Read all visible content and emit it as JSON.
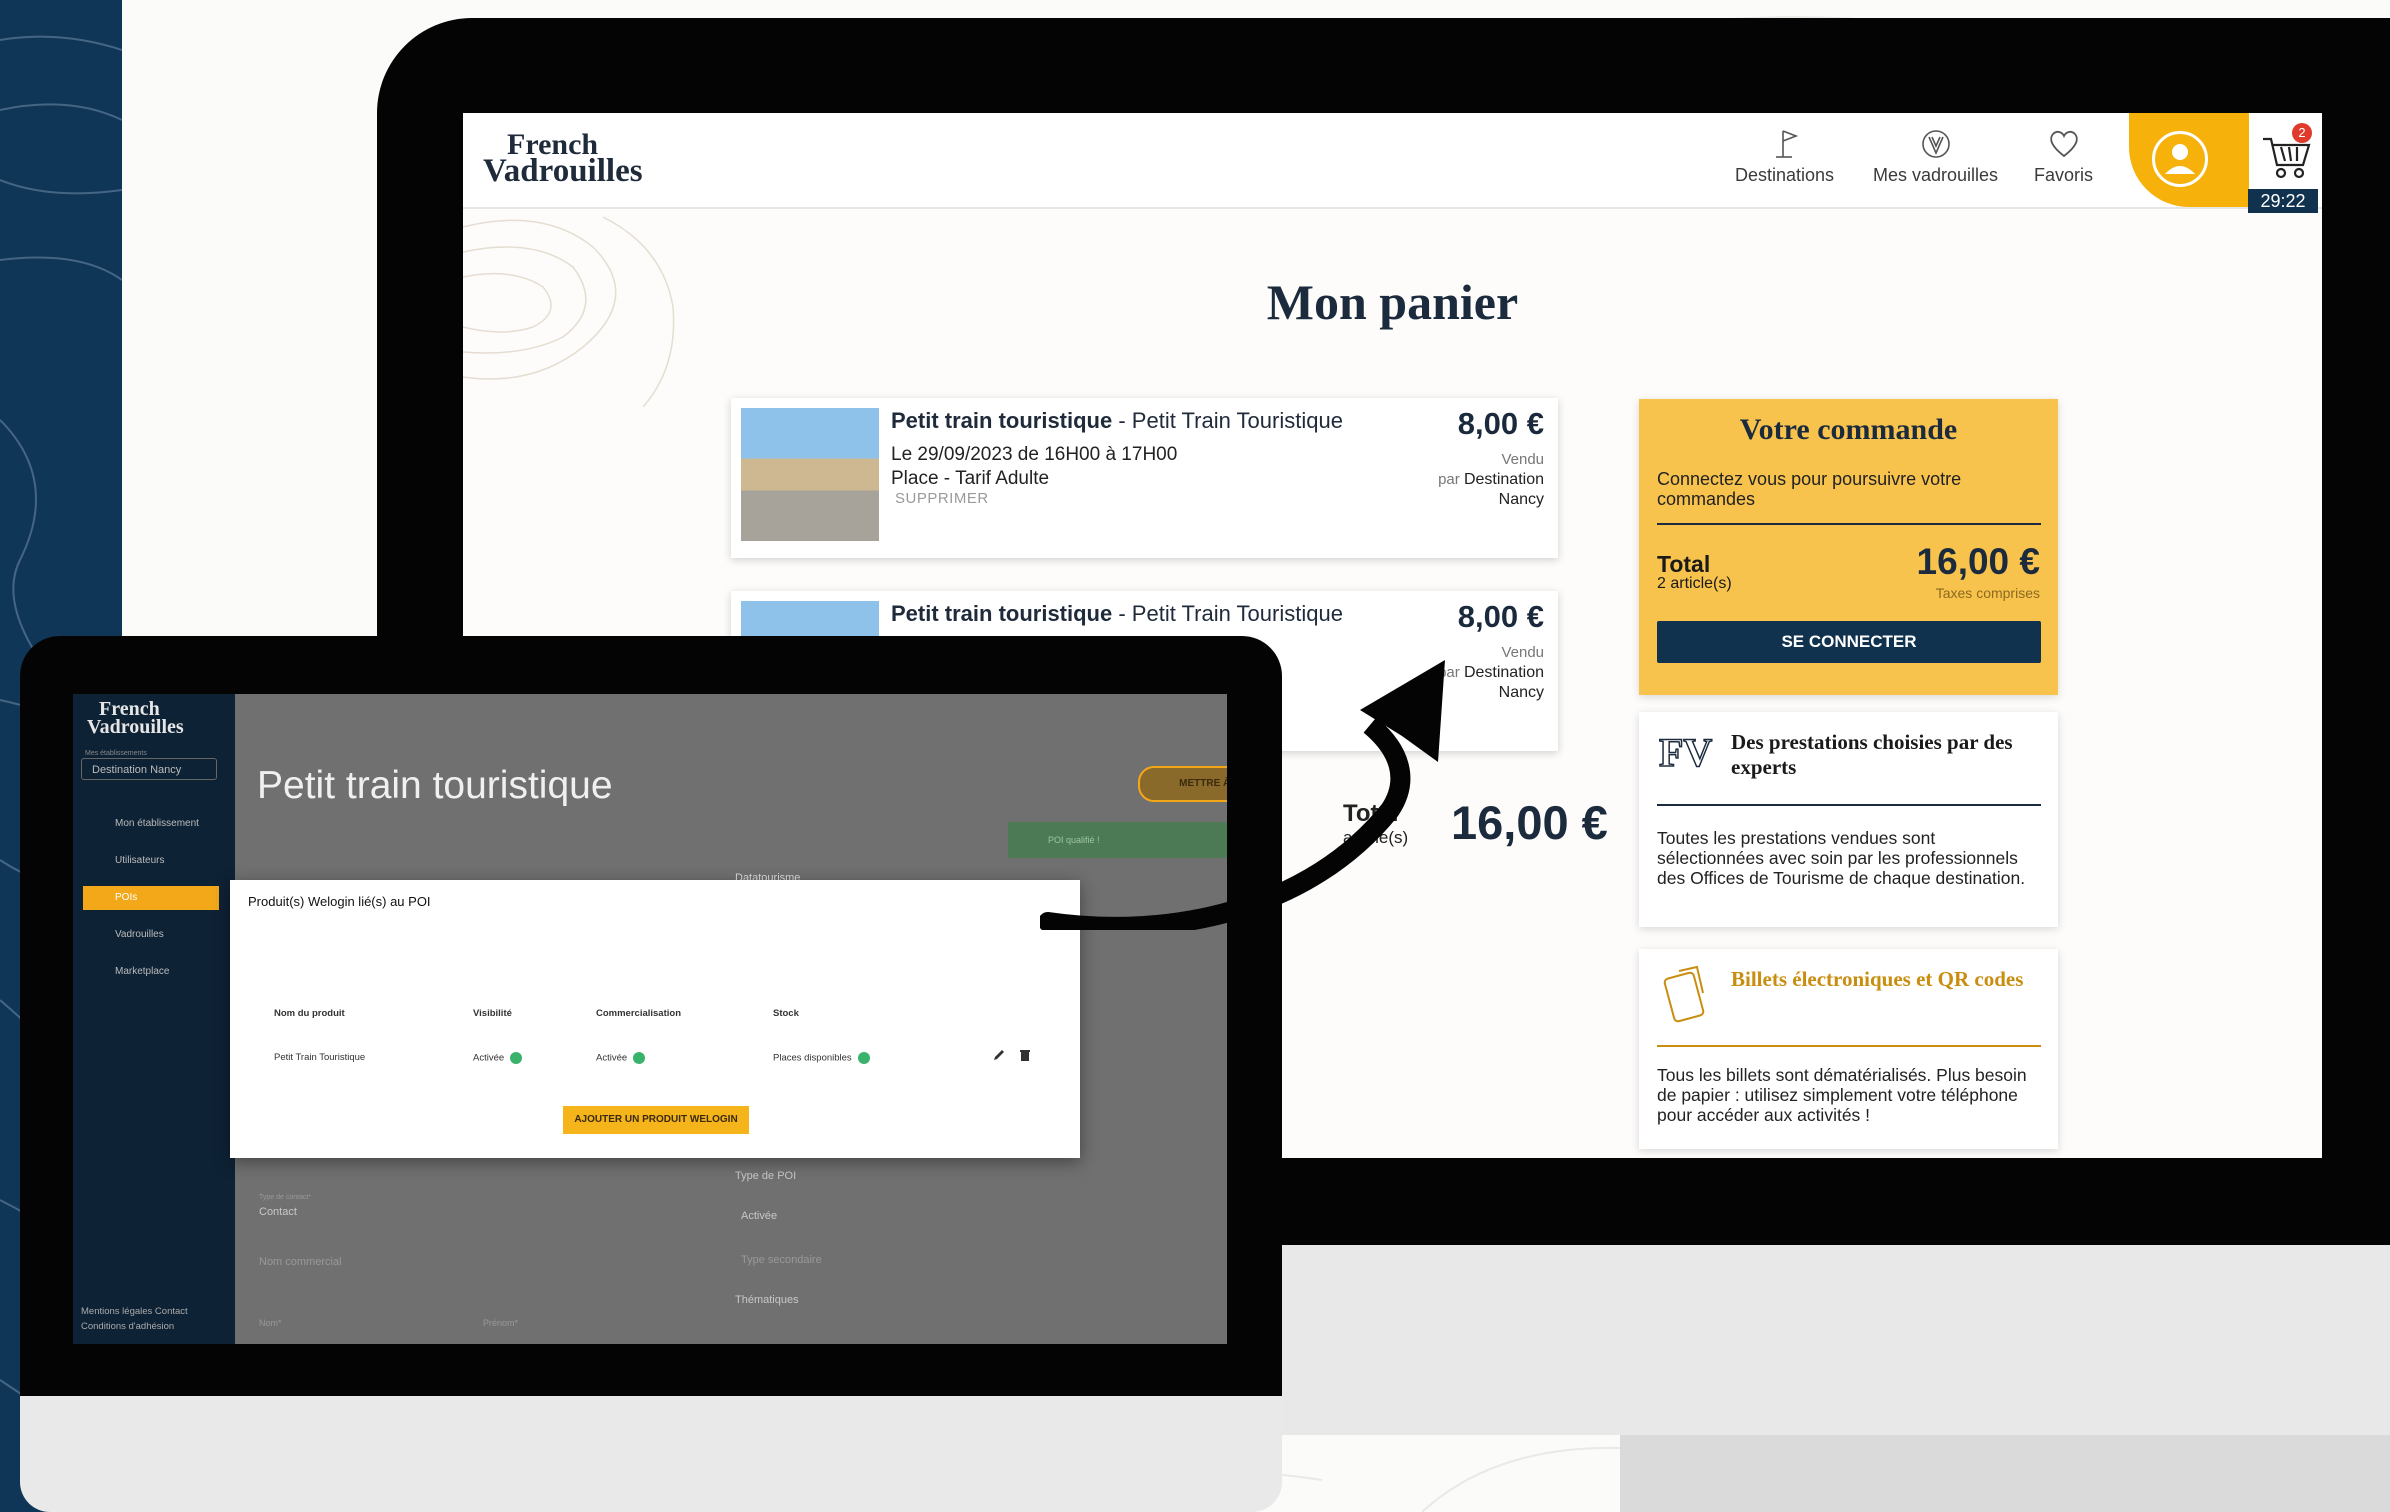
{
  "main": {
    "logo": {
      "line1": "French",
      "line2": "Vadrouilles"
    },
    "nav": [
      {
        "label": "Destinations",
        "icon": "flag-icon"
      },
      {
        "label": "Mes vadrouilles",
        "icon": "compass-icon"
      },
      {
        "label": "Favoris",
        "icon": "heart-icon"
      }
    ],
    "cart": {
      "count": "2",
      "timer": "29:22"
    },
    "page_title": "Mon panier",
    "items": [
      {
        "name": "Petit train touristique",
        "subtitle": " - Petit Train Touristique",
        "date": "Le 29/09/2023 de 16H00 à 17H00",
        "ticket": "Place - Tarif Adulte",
        "remove": "SUPPRIMER",
        "price": "8,00 €",
        "sold": "Vendu",
        "by": "par",
        "seller1": "Destination",
        "seller2": "Nancy"
      },
      {
        "name": "Petit train touristique",
        "subtitle": " - Petit Train Touristique",
        "price": "8,00 €",
        "sold": "Vendu",
        "by": "par",
        "seller1": "Destination",
        "seller2": "Nancy"
      }
    ],
    "total": {
      "label": "Total",
      "count": "article(s)",
      "value": "16,00 €"
    },
    "order": {
      "title": "Votre commande",
      "subtitle": "Connectez vous pour poursuivre votre commandes",
      "total_label": "Total",
      "articles": "2 article(s)",
      "total_value": "16,00 €",
      "taxes": "Taxes comprises",
      "button": "SE CONNECTER"
    },
    "info": [
      {
        "title": "Des prestations choisies par des experts",
        "text": "Toutes les prestations vendues sont sélectionnées avec soin par les professionnels des Offices de Tourisme de chaque destination.",
        "color": "#1b2b3d"
      },
      {
        "title": "Billets électroniques et QR codes",
        "text": "Tous les billets sont dématérialisés. Plus besoin de papier : utilisez simplement votre téléphone pour accéder aux activités !",
        "color": "#c98e10"
      }
    ]
  },
  "admin": {
    "logo": {
      "line1": "French",
      "line2": "Vadrouilles"
    },
    "establishment_label": "Mes établissements",
    "establishment": "Destination Nancy",
    "menu": [
      "Mon établissement",
      "Utilisateurs",
      "POIs",
      "Vadrouilles",
      "Marketplace"
    ],
    "footer": {
      "l1": "Mentions légales   Contact",
      "l2": "Conditions d'adhésion"
    },
    "title": "Petit train touristique",
    "update_button": "METTRE À JOUR",
    "poi_badge": "POI qualifié !",
    "datatourisme": "Datatourisme",
    "poi_type": "Type de POI",
    "poi_type_value": "Activée",
    "secondary_type": "Type secondaire",
    "thematic": "Thématiques",
    "contact_type_label": "Type de contact*",
    "contact_type": "Contact",
    "commercial_name": "Nom commercial",
    "name_field": "Nom*",
    "first_name_field": "Prénom*",
    "modal": {
      "title": "Produit(s) Welogin lié(s) au POI",
      "headers": [
        "Nom du produit",
        "Visibilité",
        "Commercialisation",
        "Stock"
      ],
      "row": [
        "Petit Train Touristique",
        "Activée",
        "Activée",
        "Places disponibles"
      ],
      "add_button": "AJOUTER UN PRODUIT WELOGIN"
    }
  },
  "colors": {
    "navy": "#0f3557",
    "accent": "#f6b20a",
    "order_bg": "#f8c34d",
    "button": "#11324f"
  }
}
